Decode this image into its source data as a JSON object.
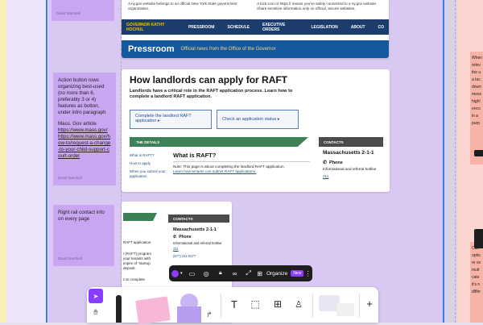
{
  "top_card": {
    "gov_notice_left": "A ny.gov website belongs to an official New York State government organization.",
    "gov_notice_right": "A lock icon or https:// means you've safely connected to a ny.gov website. Share sensitive information only on official, secure websites.",
    "nav": [
      "GOVERNOR KATHY HOCHUL",
      "PRESSROOM",
      "SCHEDULE",
      "EXECUTIVE ORDERS",
      "LEGISLATION",
      "ABOUT",
      "CO"
    ],
    "pressroom_title": "Pressroom",
    "pressroom_subtitle": "Official news from the Office of the Governor"
  },
  "raft_card": {
    "title": "How landlords can apply for RAFT",
    "intro": "Landlords have a critical role in the RAFT application process. Learn how to complete a landlord RAFT application.",
    "button1": "Complete the landlord RAFT application ▸",
    "button2": "Check an application status ▸",
    "details_label": "THE DETAILS",
    "contacts_label": "CONTACTS",
    "side_links": [
      "What is RAFT?",
      "How to apply",
      "When you submit your application"
    ],
    "section_title": "What is RAFT?",
    "note": "Note: This page is about completing the landlord RAFT application.",
    "note_link": "Learn how tenants can submit RAFT applications.",
    "contact_name": "Massachusetts 2-1-1",
    "phone_label": "Phone",
    "phone_desc": "Informational and referral hotline",
    "phone_num": "211"
  },
  "small_card": {
    "contacts_label": "CONTACTS",
    "contact_name": "Massachusetts 2-1-1",
    "phone_label": "Phone",
    "phone_desc": "Informational and referral hotline",
    "phone_num": "211",
    "extra_num": "(877) 211-6277",
    "lines": [
      "RAFT application.",
      "i (RAFT) program",
      "your tenants with",
      "impes of \"startup",
      "deposit.",
      "n to complete"
    ]
  },
  "sticky_notes": {
    "top_author": "David Marshall",
    "note2_text": "Action button rows organizing best-used (no more than 6, preferably 3 or 4) features as button, under intro paragraph",
    "note2_text2": "Mass. Gov article",
    "note2_link1": "https://www.mass.gov/",
    "note2_link2": "https://www.mass.gov/how-to/request-a-change-to-your-child-support-court-order",
    "note2_author": "David Marshall",
    "note3_text": "Right rail contact info on every page",
    "note3_author": "David Marshall"
  },
  "right_notes": {
    "lines1": [
      "When",
      "relev",
      "the u",
      "a tac",
      "down",
      "mess",
      "highl",
      "enco",
      "in a",
      "purp"
    ],
    "lines2": [
      "Curr",
      "optio",
      "re ov",
      "mult",
      "cate",
      "it's n",
      "differ"
    ]
  },
  "toolbar": {
    "organize_label": "Organize",
    "new_badge": "New"
  },
  "colors": {
    "purple_canvas": "#d9c8f2",
    "sticky_purple": "#c9a6f2",
    "accent_blue": "#3b7be6",
    "green_bar": "#3d8055"
  }
}
